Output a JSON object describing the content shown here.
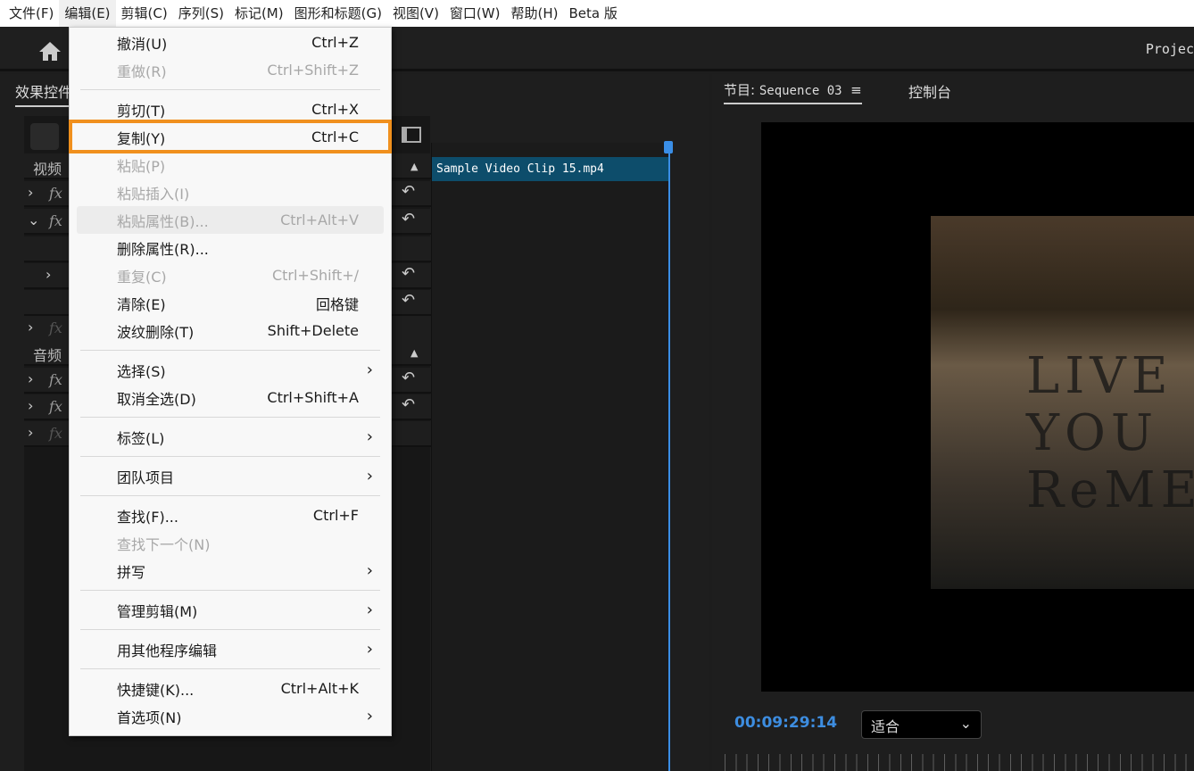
{
  "menubar": [
    "文件(F)",
    "编辑(E)",
    "剪辑(C)",
    "序列(S)",
    "标记(M)",
    "图形和标题(G)",
    "视图(V)",
    "窗口(W)",
    "帮助(H)",
    "Beta 版"
  ],
  "topbar": {
    "project": "Projec"
  },
  "effects_panel": {
    "tab": "效果控件",
    "video_label": "视频",
    "audio_label": "音频",
    "clip_name": "Sample Video Clip 15.mp4"
  },
  "program": {
    "tab": "节目:",
    "sequence": "Sequence 03",
    "console_tab": "控制台",
    "timecode": "00:09:29:14",
    "fit": "适合",
    "grafitti": "LIVE\nYOU\nReME"
  },
  "highlight_color": "#f0901e",
  "edit_menu": [
    {
      "label": "撤消(U)",
      "shortcut": "Ctrl+Z"
    },
    {
      "label": "重做(R)",
      "shortcut": "Ctrl+Shift+Z",
      "disabled": true
    },
    {
      "sep": true
    },
    {
      "label": "剪切(T)",
      "shortcut": "Ctrl+X"
    },
    {
      "label": "复制(Y)",
      "shortcut": "Ctrl+C"
    },
    {
      "label": "粘贴(P)",
      "shortcut": "",
      "disabled": true
    },
    {
      "label": "粘贴插入(I)",
      "shortcut": "",
      "disabled": true
    },
    {
      "label": "粘贴属性(B)...",
      "shortcut": "Ctrl+Alt+V",
      "disabled": true,
      "hover": true
    },
    {
      "label": "删除属性(R)...",
      "shortcut": ""
    },
    {
      "label": "重复(C)",
      "shortcut": "Ctrl+Shift+/",
      "disabled": true
    },
    {
      "label": "清除(E)",
      "shortcut": "回格键"
    },
    {
      "label": "波纹删除(T)",
      "shortcut": "Shift+Delete"
    },
    {
      "sep": true
    },
    {
      "label": "选择(S)",
      "submenu": true
    },
    {
      "label": "取消全选(D)",
      "shortcut": "Ctrl+Shift+A"
    },
    {
      "sep": true
    },
    {
      "label": "标签(L)",
      "submenu": true
    },
    {
      "sep": true
    },
    {
      "label": "团队项目",
      "submenu": true
    },
    {
      "sep": true
    },
    {
      "label": "查找(F)...",
      "shortcut": "Ctrl+F"
    },
    {
      "label": "查找下一个(N)",
      "shortcut": "",
      "disabled": true
    },
    {
      "label": "拼写",
      "submenu": true
    },
    {
      "sep": true
    },
    {
      "label": "管理剪辑(M)",
      "submenu": true
    },
    {
      "sep": true
    },
    {
      "label": "用其他程序编辑",
      "submenu": true
    },
    {
      "sep": true
    },
    {
      "label": "快捷键(K)...",
      "shortcut": "Ctrl+Alt+K"
    },
    {
      "label": "首选项(N)",
      "submenu": true
    }
  ]
}
